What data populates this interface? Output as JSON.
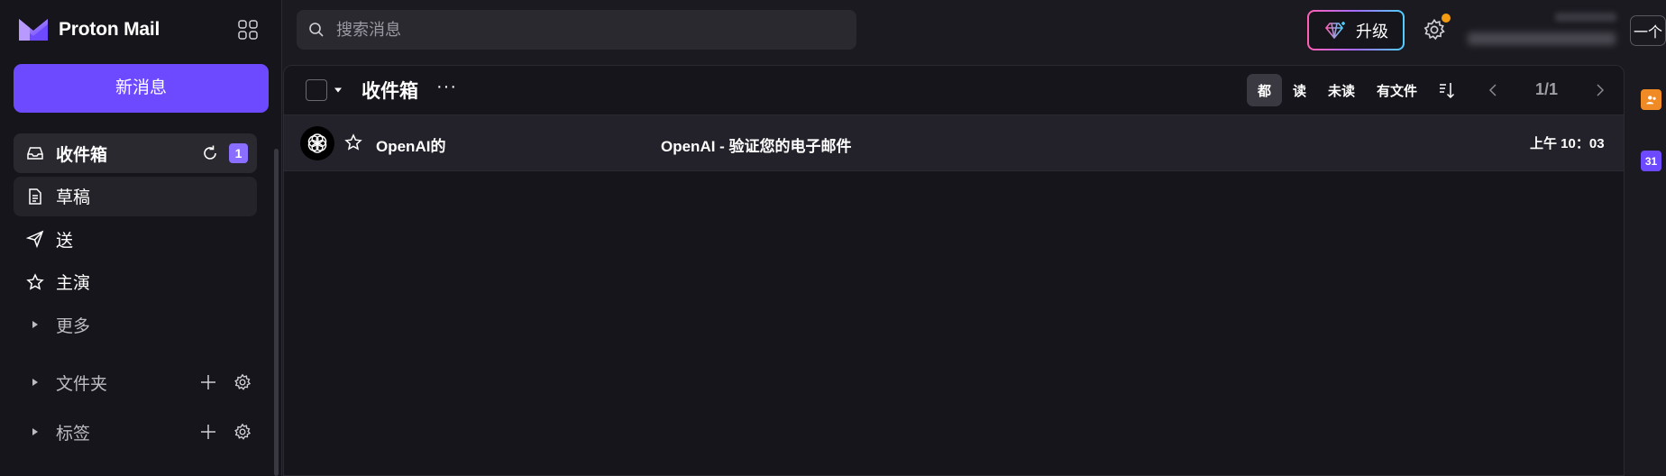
{
  "brand": {
    "name": "Proton Mail"
  },
  "sidebar": {
    "compose_label": "新消息",
    "items": [
      {
        "label": "收件箱",
        "icon": "inbox-icon",
        "badge": "1"
      },
      {
        "label": "草稿",
        "icon": "draft-icon"
      },
      {
        "label": "送",
        "icon": "send-icon"
      },
      {
        "label": "主演",
        "icon": "star-icon"
      },
      {
        "label": "更多"
      }
    ],
    "sections": [
      {
        "label": "文件夹"
      },
      {
        "label": "标签"
      }
    ]
  },
  "search": {
    "placeholder": "搜索消息"
  },
  "topbar": {
    "upgrade_label": "升级",
    "account_button": "一个"
  },
  "toolbar": {
    "folder_title": "收件箱",
    "more": "···",
    "filters": [
      "都",
      "读",
      "未读",
      "有文件"
    ],
    "active_filter": "都",
    "page": "1/1"
  },
  "messages": [
    {
      "sender": "OpenAI的",
      "subject": "OpenAI - 验证您的电子邮件",
      "time": "上午 10：03"
    }
  ],
  "rail": {
    "calendar_day": "31"
  },
  "colors": {
    "accent": "#6d4aff",
    "badge": "#8a6eff",
    "notification_dot": "#f39c12"
  }
}
